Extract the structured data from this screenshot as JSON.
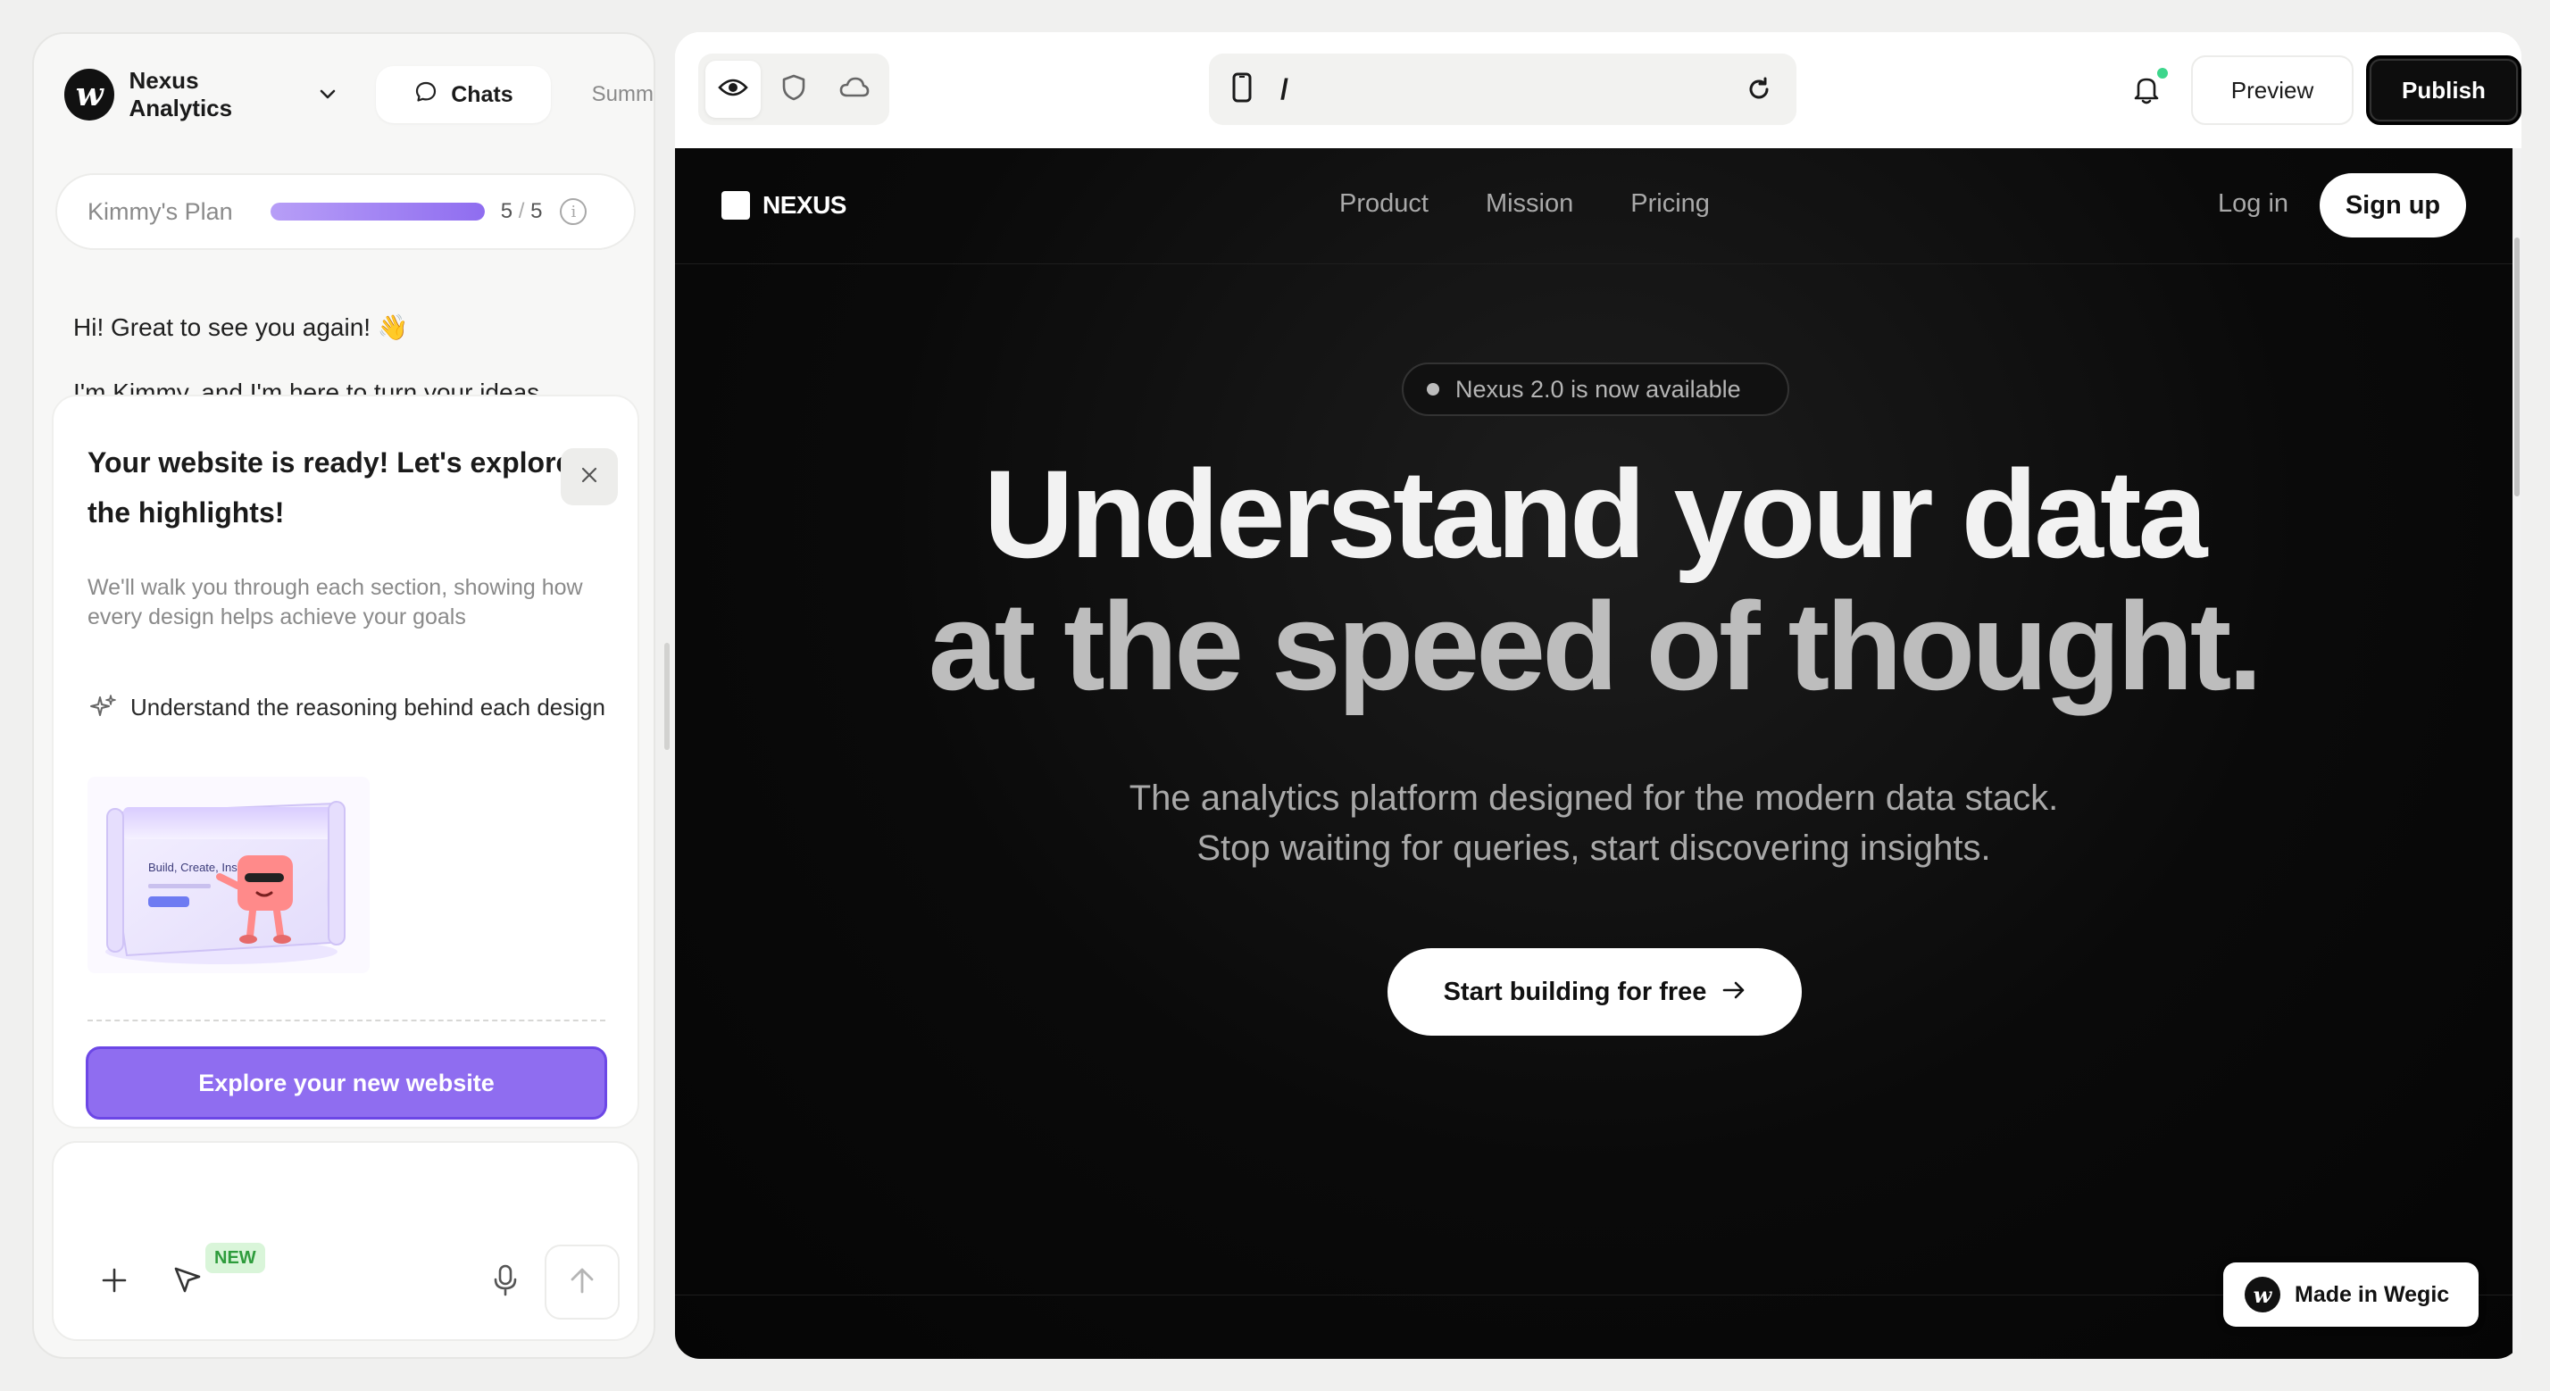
{
  "header": {
    "logo_glyph": "w",
    "project_name": "Nexus Analytics",
    "tabs": [
      {
        "label": "Chats",
        "icon": "chat-bubble-icon",
        "active": true
      },
      {
        "label": "Summ",
        "active": false
      }
    ]
  },
  "plan": {
    "label": "Kimmy's Plan",
    "progress": 1.0,
    "used": "5",
    "separator": "/",
    "total": "5"
  },
  "messages": [
    "Hi! Great to see you again! 👋",
    "I'm Kimmy, and I'm here to turn your ideas"
  ],
  "tour": {
    "title": "Your website is ready! Let's explore the highlights!",
    "subtitle": "We'll walk you through each section, showing how every design helps achieve your goals",
    "feature": "Understand the reasoning behind each design",
    "illustration_text": "Build, Create, Inspire",
    "button_label": "Explore your new website"
  },
  "composer": {
    "new_badge": "NEW"
  },
  "toolbar": {
    "url_path": "/",
    "preview_label": "Preview",
    "publish_label": "Publish",
    "notification_dot_color": "#3dd68c"
  },
  "site": {
    "logo_text": "NEXUS",
    "nav_links": [
      "Product",
      "Mission",
      "Pricing"
    ],
    "login_label": "Log in",
    "signup_label": "Sign up",
    "announcement": "Nexus 2.0 is now available",
    "hero_line1": "Understand your data",
    "hero_line2": "at the speed of thought.",
    "hero_sub": "The analytics platform designed for the modern data stack. Stop waiting for queries, start discovering insights.",
    "cta_label": "Start building for free",
    "made_in": "Made in Wegic"
  },
  "colors": {
    "accent": "#8f6df0",
    "site_bg": "#0a0a0a",
    "publish_bg": "#0d0d0d"
  }
}
